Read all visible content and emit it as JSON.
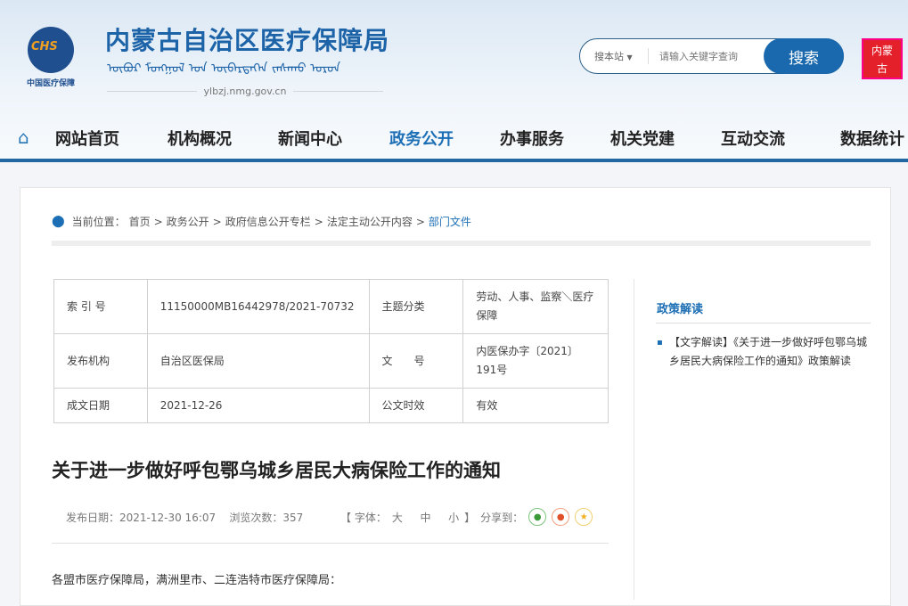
{
  "header": {
    "logo_text": "CHS",
    "logo_caption": "中国医疗保障",
    "site_name": "内蒙古自治区医疗保障局",
    "mongolian_script": "ᠥᠪᠦᠷ ᠮᠣᠩᠭᠣᠯ ᠤᠨ ᠥᠪᠡᠷᠲᠡᠭᠡᠨ ᠵᠠᠰᠠᠬᠤ ᠣᠷᠤᠨ",
    "domain": "ylbzj.nmg.gov.cn",
    "seal_text": "内蒙古"
  },
  "search": {
    "scope": "搜本站",
    "placeholder": "请输入关键字查询",
    "button": "搜索"
  },
  "nav": {
    "items": [
      "网站首页",
      "机构概况",
      "新闻中心",
      "政务公开",
      "办事服务",
      "机关党建",
      "互动交流",
      "数据统计"
    ],
    "active": "政务公开"
  },
  "breadcrumb": {
    "label": "当前位置：",
    "items": [
      "首页",
      "政务公开",
      "政府信息公开专栏",
      "法定主动公开内容",
      "部门文件"
    ]
  },
  "info_table": [
    [
      "索 引 号",
      "11150000MB16442978/2021-70732",
      "主题分类",
      "劳动、人事、监察＼医疗保障"
    ],
    [
      "发布机构",
      "自治区医保局",
      "文　　号",
      "内医保办字〔2021〕191号"
    ],
    [
      "成文日期",
      "2021-12-26",
      "公文时效",
      "有效"
    ]
  ],
  "sidebar": {
    "title": "政策解读",
    "items": [
      "【文字解读】《关于进一步做好呼包鄂乌城乡居民大病保险工作的通知》政策解读"
    ]
  },
  "article": {
    "title": "关于进一步做好呼包鄂乌城乡居民大病保险工作的通知",
    "publish_date": "发布日期：2021-12-30 16:07",
    "views": "浏览次数：357",
    "font_label": "【 字体：",
    "font_large": "大",
    "font_medium": "中",
    "font_small": "小",
    "font_end": "】",
    "share_label": "分享到：",
    "body": "各盟市医疗保障局，满洲里市、二连浩特市医疗保障局："
  }
}
